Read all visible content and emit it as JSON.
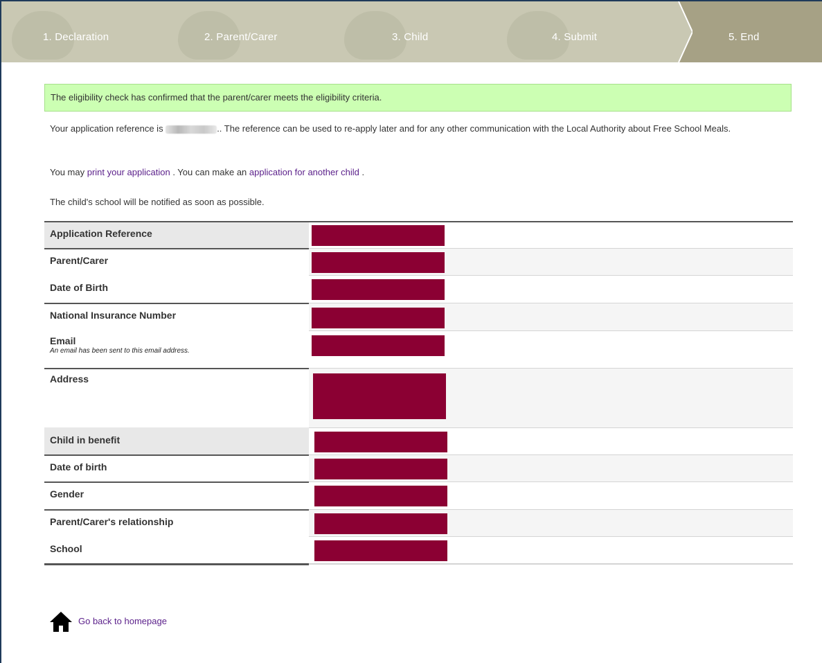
{
  "steps": [
    {
      "label": "1.  Declaration"
    },
    {
      "label": "2.  Parent/Carer"
    },
    {
      "label": "3.  Child"
    },
    {
      "label": "4.  Submit"
    },
    {
      "label": "5.  End"
    }
  ],
  "alert": "The eligibility check has confirmed that the parent/carer meets the eligibility criteria.",
  "reference_para": {
    "prefix": "Your application reference is ",
    "suffix": ".. The reference can be used to re-apply later and for any other communication with the Local Authority about Free School Meals."
  },
  "print_para": {
    "prefix": "You may ",
    "print_link": "print your application",
    "middle": " . You can make an ",
    "another_link": "application for another child",
    "suffix": " ."
  },
  "notify_para": "The child's school will be notified as soon as possible.",
  "table": {
    "rows": [
      {
        "label": "Application Reference"
      },
      {
        "label": "Parent/Carer"
      },
      {
        "label": "Date of Birth"
      },
      {
        "label": "National Insurance Number"
      },
      {
        "label": "Email",
        "note": "An email has been sent to this email address."
      },
      {
        "label": "Address"
      },
      {
        "label": "Child in benefit"
      },
      {
        "label": "Date of birth"
      },
      {
        "label": "Gender"
      },
      {
        "label": "Parent/Carer's relationship"
      },
      {
        "label": "School"
      }
    ]
  },
  "home_link": "Go back to homepage",
  "icons": {
    "home": "home-icon",
    "step-arrow": "chevron-right-icon"
  },
  "colors": {
    "redaction": "#8b0033",
    "alert_bg": "#ccffb3",
    "link": "#5a1f8a",
    "step_bar": "#c9c8b3",
    "step_active": "#a6a185"
  }
}
